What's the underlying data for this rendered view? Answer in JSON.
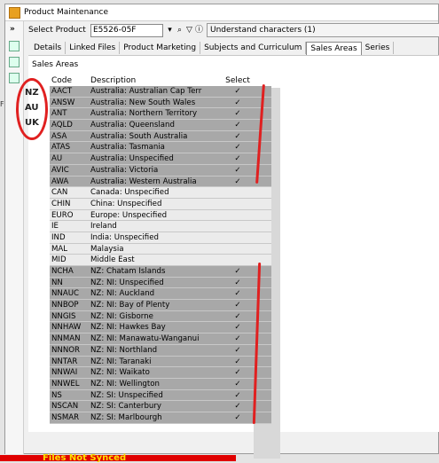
{
  "window": {
    "title": "Product Maintenance"
  },
  "product": {
    "label": "Select Product",
    "code": "E5526-05F",
    "title": "Understand characters (1)"
  },
  "tabs": [
    "Details",
    "Linked Files",
    "Product Marketing",
    "Subjects and Curriculum",
    "Sales Areas",
    "Series"
  ],
  "active_tab": "Sales Areas",
  "panel_title": "Sales Areas",
  "grid": {
    "headers": {
      "code": "Code",
      "description": "Description",
      "select": "Select"
    },
    "rows": [
      {
        "code": "AACT",
        "desc": "Australia: Australian Cap Terr",
        "sel": "✓"
      },
      {
        "code": "ANSW",
        "desc": "Australia: New South Wales",
        "sel": "✓"
      },
      {
        "code": "ANT",
        "desc": "Australia: Northern Territory",
        "sel": "✓"
      },
      {
        "code": "AQLD",
        "desc": "Australia: Queensland",
        "sel": "✓"
      },
      {
        "code": "ASA",
        "desc": "Australia: South Australia",
        "sel": "✓"
      },
      {
        "code": "ATAS",
        "desc": "Australia: Tasmania",
        "sel": "✓"
      },
      {
        "code": "AU",
        "desc": "Australia: Unspecified",
        "sel": "✓"
      },
      {
        "code": "AVIC",
        "desc": "Australia: Victoria",
        "sel": "✓"
      },
      {
        "code": "AWA",
        "desc": "Australia: Western Australia",
        "sel": "✓"
      },
      {
        "code": "CAN",
        "desc": "Canada: Unspecified",
        "sel": ""
      },
      {
        "code": "CHIN",
        "desc": "China: Unspecified",
        "sel": ""
      },
      {
        "code": "EURO",
        "desc": "Europe: Unspecified",
        "sel": ""
      },
      {
        "code": "IE",
        "desc": "Ireland",
        "sel": ""
      },
      {
        "code": "IND",
        "desc": "India: Unspecified",
        "sel": ""
      },
      {
        "code": "MAL",
        "desc": "Malaysia",
        "sel": ""
      },
      {
        "code": "MID",
        "desc": "Middle East",
        "sel": ""
      },
      {
        "code": "NCHA",
        "desc": "NZ: Chatam Islands",
        "sel": "✓"
      },
      {
        "code": "NN",
        "desc": "NZ: NI: Unspecified",
        "sel": "✓"
      },
      {
        "code": "NNAUC",
        "desc": "NZ: NI: Auckland",
        "sel": "✓"
      },
      {
        "code": "NNBOP",
        "desc": "NZ: NI: Bay of Plenty",
        "sel": "✓"
      },
      {
        "code": "NNGIS",
        "desc": "NZ: NI: Gisborne",
        "sel": "✓"
      },
      {
        "code": "NNHAW",
        "desc": "NZ: NI: Hawkes Bay",
        "sel": "✓"
      },
      {
        "code": "NNMAN",
        "desc": "NZ: NI: Manawatu-Wanganui",
        "sel": "✓"
      },
      {
        "code": "NNNOR",
        "desc": "NZ: NI: Northland",
        "sel": "✓"
      },
      {
        "code": "NNTAR",
        "desc": "NZ: NI: Taranaki",
        "sel": "✓"
      },
      {
        "code": "NNWAI",
        "desc": "NZ: NI: Waikato",
        "sel": "✓"
      },
      {
        "code": "NNWEL",
        "desc": "NZ: NI: Wellington",
        "sel": "✓"
      },
      {
        "code": "NS",
        "desc": "NZ: SI: Unspecified",
        "sel": "✓"
      },
      {
        "code": "NSCAN",
        "desc": "NZ: SI: Canterbury",
        "sel": "✓"
      },
      {
        "code": "NSMAR",
        "desc": "NZ: SI: Marlbourgh",
        "sel": "✓"
      }
    ]
  },
  "annotation": {
    "lines": [
      "NZ",
      "AU",
      "UK"
    ]
  },
  "status_bar": {
    "text": "Files Not Synced"
  },
  "colors": {
    "annotation": "#e02020",
    "status_bg": "#e00000",
    "status_text": "#ffe000"
  }
}
